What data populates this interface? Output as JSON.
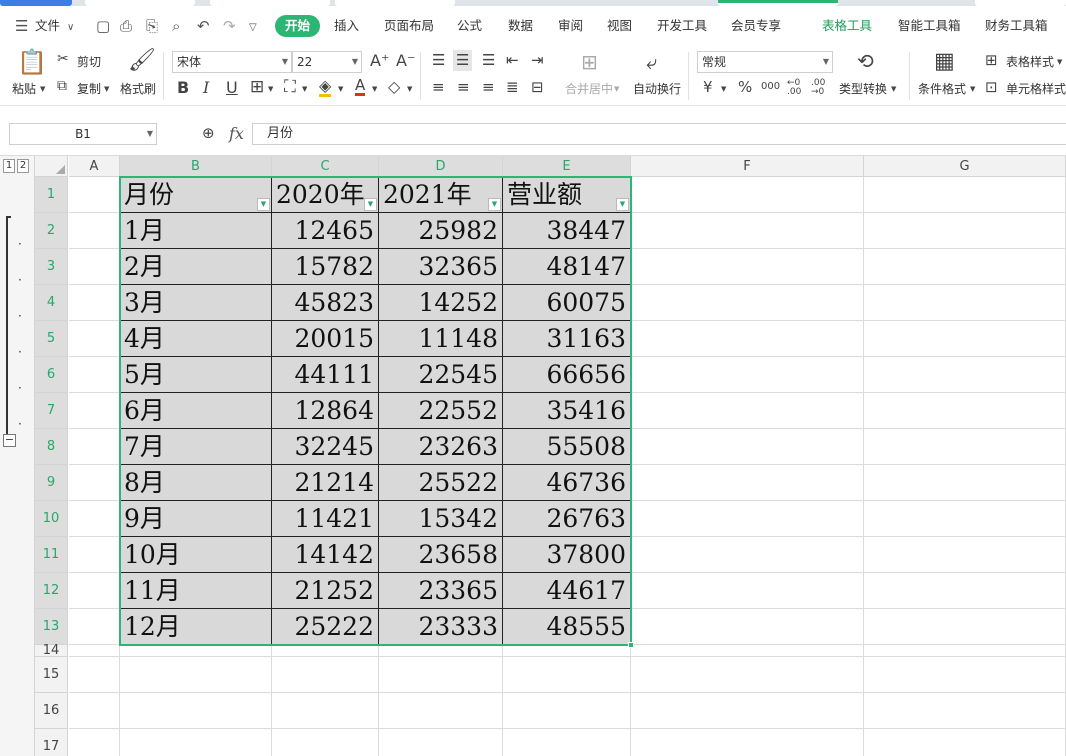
{
  "menu": {
    "file_label": "文件",
    "tabs": [
      "开始",
      "插入",
      "页面布局",
      "公式",
      "数据",
      "审阅",
      "视图",
      "开发工具",
      "会员专享"
    ],
    "contextual_tabs": [
      "表格工具",
      "智能工具箱",
      "财务工具箱"
    ]
  },
  "ribbon": {
    "paste": "粘贴",
    "cut": "剪切",
    "copy": "复制",
    "format_painter": "格式刷",
    "font_name": "宋体",
    "font_size": "22",
    "merge_center": "合并居中",
    "wrap_text": "自动换行",
    "number_format": "常规",
    "type_convert": "类型转换",
    "conditional_format": "条件格式",
    "table_style": "表格样式",
    "cell_style": "单元格样式",
    "currency_symbol": "¥",
    "percent_symbol": "%",
    "thousands_symbol": "000",
    "inc_decimal": "+.0\n.00",
    "dec_decimal": ".00\n→.0"
  },
  "formula_bar": {
    "name_box": "B1",
    "fx_label": "fx",
    "content": "月份"
  },
  "outline_levels": [
    "1",
    "2"
  ],
  "columns": [
    "A",
    "B",
    "C",
    "D",
    "E",
    "F",
    "G"
  ],
  "rows": [
    "1",
    "2",
    "3",
    "4",
    "5",
    "6",
    "7",
    "8",
    "9",
    "10",
    "11",
    "12",
    "13",
    "14",
    "15",
    "16",
    "17"
  ],
  "table": {
    "headers": [
      "月份",
      "2020年",
      "2021年",
      "营业额"
    ],
    "rows": [
      [
        "1月",
        "12465",
        "25982",
        "38447"
      ],
      [
        "2月",
        "15782",
        "32365",
        "48147"
      ],
      [
        "3月",
        "45823",
        "14252",
        "60075"
      ],
      [
        "4月",
        "20015",
        "11148",
        "31163"
      ],
      [
        "5月",
        "44111",
        "22545",
        "66656"
      ],
      [
        "6月",
        "12864",
        "22552",
        "35416"
      ],
      [
        "7月",
        "32245",
        "23263",
        "55508"
      ],
      [
        "8月",
        "21214",
        "25522",
        "46736"
      ],
      [
        "9月",
        "11421",
        "15342",
        "26763"
      ],
      [
        "10月",
        "14142",
        "23658",
        "37800"
      ],
      [
        "11月",
        "21252",
        "23365",
        "44617"
      ],
      [
        "12月",
        "25222",
        "23333",
        "48555"
      ]
    ]
  },
  "colors": {
    "accent": "#2bb673",
    "selected_header_text": "#2aa66a",
    "table_fill": "#d9d9d9"
  }
}
